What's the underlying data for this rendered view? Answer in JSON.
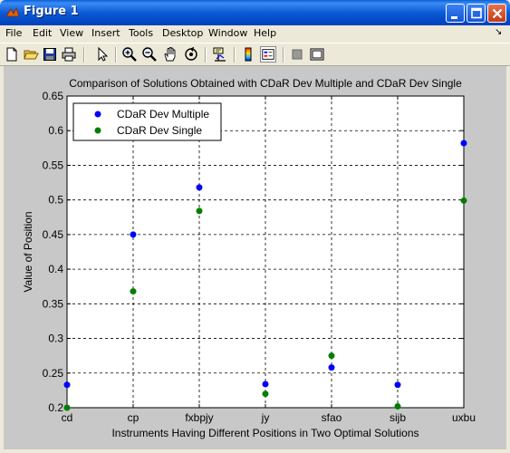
{
  "window": {
    "title": "Figure 1"
  },
  "menu": {
    "items": [
      "File",
      "Edit",
      "View",
      "Insert",
      "Tools",
      "Desktop",
      "Window",
      "Help"
    ],
    "arrow": "↘"
  },
  "toolbar": {
    "icons": [
      "new-file-icon",
      "open-file-icon",
      "save-icon",
      "print-icon",
      "arrow-select-icon",
      "zoom-in-icon",
      "zoom-out-icon",
      "pan-hand-icon",
      "rotate-3d-icon",
      "data-cursor-icon",
      "colorbar-icon",
      "legend-icon",
      "hide-plot-tools-icon",
      "show-plot-tools-icon"
    ]
  },
  "colors": {
    "series1": "#0000ff",
    "series2": "#007f00",
    "figure_bg": "#c8c8c8",
    "axes_bg": "#ffffff"
  },
  "chart_data": {
    "type": "scatter",
    "title": "Comparison of Solutions Obtained with CDaR Dev Multiple and CDaR Dev Single",
    "xlabel": "Instruments Having Different Positions in Two Optimal Solutions",
    "ylabel": "Value of Position",
    "categories": [
      "cd",
      "cp",
      "fxbpjy",
      "jy",
      "sfao",
      "sijb",
      "uxbu"
    ],
    "ylim": [
      0.2,
      0.65
    ],
    "yticks": [
      "0.2",
      "0.25",
      "0.3",
      "0.35",
      "0.4",
      "0.45",
      "0.5",
      "0.55",
      "0.6",
      "0.65"
    ],
    "grid": true,
    "legend_position": "top-left",
    "series": [
      {
        "name": "CDaR Dev Multiple",
        "values": [
          0.233,
          0.45,
          0.518,
          0.234,
          0.258,
          0.233,
          0.582
        ]
      },
      {
        "name": "CDaR Dev Single",
        "values": [
          0.2,
          0.368,
          0.484,
          0.22,
          0.275,
          0.202,
          0.499
        ]
      }
    ]
  }
}
